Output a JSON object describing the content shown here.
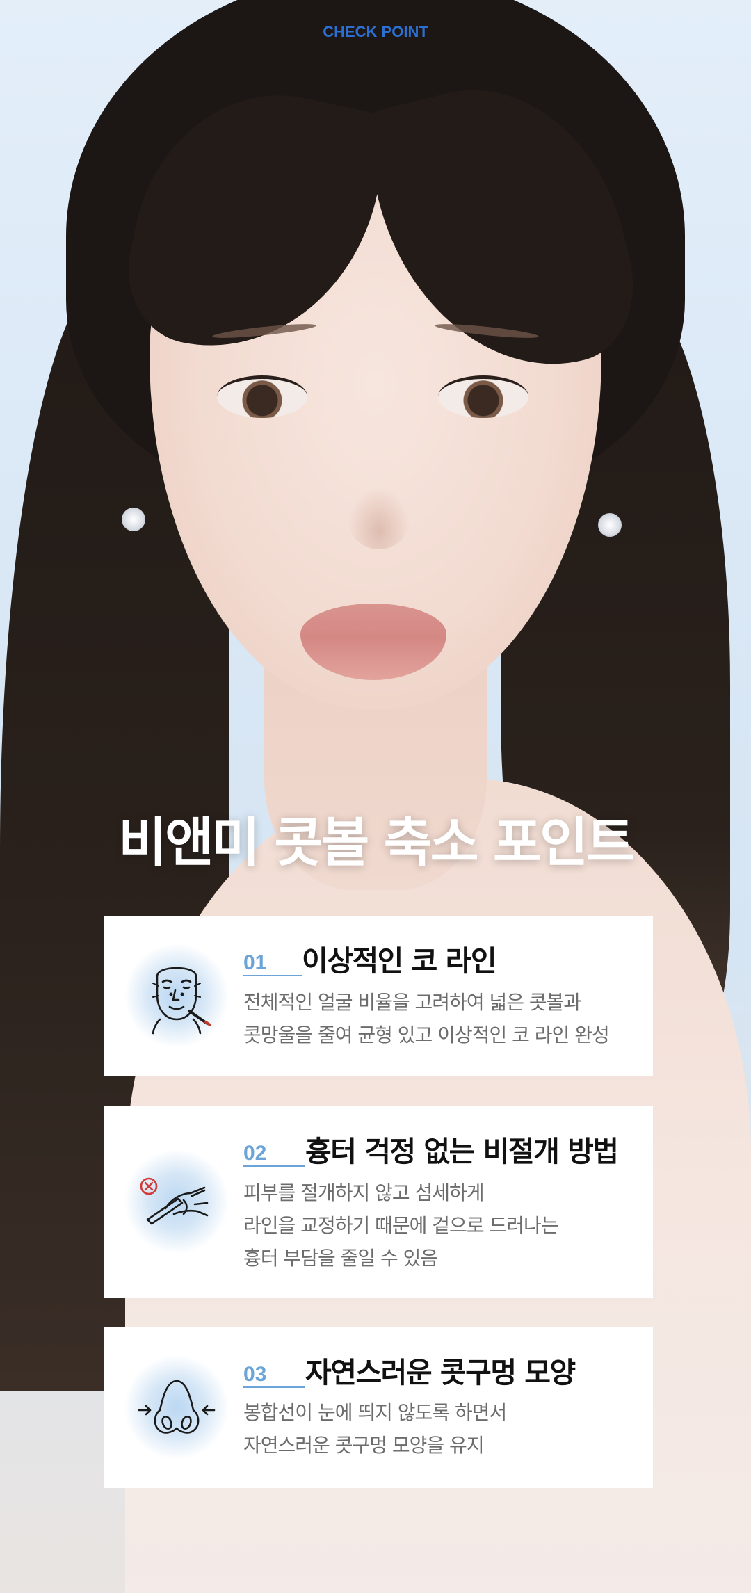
{
  "header": {
    "label": "CHECK POINT"
  },
  "hero": {
    "title": "비앤미 콧볼 축소 포인트"
  },
  "points": [
    {
      "number": "01",
      "title": "이상적인 코 라인",
      "icon": "face-measure-icon",
      "lines": [
        "전체적인 얼굴 비율을 고려하여 넓은 콧볼과",
        "콧망울을 줄여 균형 있고 이상적인 코 라인 완성"
      ]
    },
    {
      "number": "02",
      "title": "흉터 걱정 없는 비절개 방법",
      "icon": "no-scalpel-icon",
      "lines": [
        "피부를 절개하지 않고 섬세하게",
        "라인을 교정하기 때문에 겉으로 드러나는",
        "흉터 부담을 줄일 수 있음"
      ]
    },
    {
      "number": "03",
      "title": "자연스러운 콧구멍 모양",
      "icon": "nostril-icon",
      "lines": [
        "봉합선이 눈에 띄지 않도록 하면서",
        "자연스러운 콧구멍 모양을 유지"
      ]
    }
  ],
  "colors": {
    "accent": "#2c6fd1",
    "number": "#6aa4d8",
    "title": "#111111",
    "body": "#6c6c6c"
  }
}
